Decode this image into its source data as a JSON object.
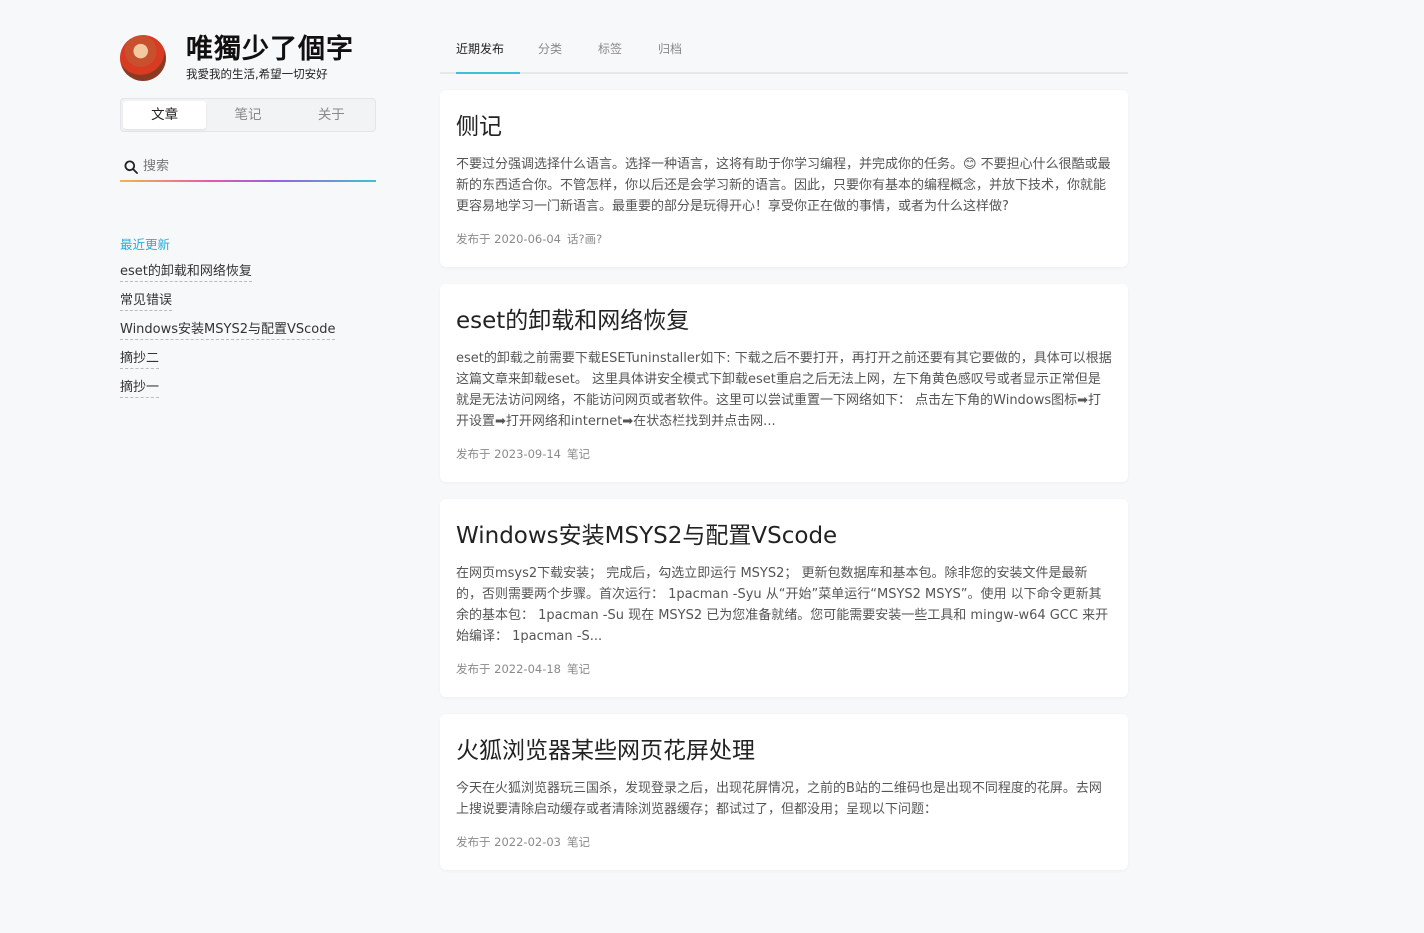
{
  "site": {
    "title": "唯獨少了個字",
    "subtitle": "我愛我的生活,希望一切安好"
  },
  "nav_tabs": [
    {
      "label": "文章",
      "active": true
    },
    {
      "label": "笔记",
      "active": false
    },
    {
      "label": "关于",
      "active": false
    }
  ],
  "search": {
    "placeholder": "搜索",
    "value": ""
  },
  "recent": {
    "heading": "最近更新",
    "items": [
      "eset的卸载和网络恢复",
      "常见错误",
      "Windows安装MSYS2与配置VScode",
      "摘抄二",
      "摘抄一"
    ]
  },
  "top_tabs": [
    {
      "label": "近期发布",
      "active": true
    },
    {
      "label": "分类",
      "active": false
    },
    {
      "label": "标签",
      "active": false
    },
    {
      "label": "归档",
      "active": false
    }
  ],
  "posts": [
    {
      "title": "侧记",
      "excerpt": "不要过分强调选择什么语言。选择一种语言，这将有助于你学习编程，并完成你的任务。😊 不要担心什么很酷或最新的东西适合你。不管怎样，你以后还是会学习新的语言。因此，只要你有基本的编程概念，并放下技术，你就能更容易地学习一门新语言。最重要的部分是玩得开心！享受你正在做的事情，或者为什么这样做?",
      "date": "发布于 2020-06-04",
      "category": "话?画?"
    },
    {
      "title": "eset的卸载和网络恢复",
      "excerpt": "eset的卸载之前需要下载ESETuninstaller如下: 下载之后不要打开，再打开之前还要有其它要做的，具体可以根据这篇文章来卸载eset。 这里具体讲安全模式下卸载eset重启之后无法上网，左下角黄色感叹号或者显示正常但是就是无法访问网络，不能访问网页或者软件。这里可以尝试重置一下网络如下： 点击左下角的Windows图标➡打开设置➡打开网络和internet➡在状态栏找到并点击网...",
      "date": "发布于 2023-09-14",
      "category": "笔记"
    },
    {
      "title": "Windows安装MSYS2与配置VScode",
      "excerpt": "在网页msys2下载安装； 完成后，勾选立即运行 MSYS2； 更新包数据库和基本包。除非您的安装文件是最新的，否则需要两个步骤。首次运行： 1pacman -Syu 从“开始”菜单运行“MSYS2 MSYS”。使用 以下命令更新其余的基本包： 1pacman -Su 现在 MSYS2 已为您准备就绪。您可能需要安装一些工具和 mingw-w64 GCC 来开始编译： 1pacman -S...",
      "date": "发布于 2022-04-18",
      "category": "笔记"
    },
    {
      "title": "火狐浏览器某些网页花屏处理",
      "excerpt": "今天在火狐浏览器玩三国杀，发现登录之后，出现花屏情况，之前的B站的二维码也是出现不同程度的花屏。去网上搜说要清除启动缓存或者清除浏览器缓存；都试过了，但都没用；呈现以下问题：",
      "date": "发布于 2022-02-03",
      "category": "笔记"
    }
  ]
}
